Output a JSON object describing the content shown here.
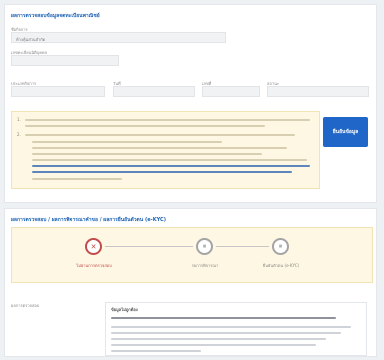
{
  "panel1": {
    "title": "ผลการตรวจสอบข้อมูลจดทะเบียนพาณิชย์",
    "fields": [
      {
        "label": "ชื่อกิจการ",
        "value": "ห้างหุ้นส่วนจำกัด"
      },
      {
        "label": "เลขทะเบียนนิติบุคคล",
        "value": ""
      },
      {
        "label": "ประเภทกิจการ",
        "value": ""
      },
      {
        "label": "วันที่",
        "value": ""
      },
      {
        "label": "เลขที่",
        "value": ""
      },
      {
        "label": "สถานะ",
        "value": ""
      }
    ],
    "notice_numbers": [
      "1.",
      "2."
    ],
    "button_label": "ยืนยันข้อมูล"
  },
  "panel2": {
    "title": "ผลการตรวจสอบ / ผลการพิจารณาคำขอ / ผลการยืนยันตัวตน (e-KYC)",
    "steps": [
      {
        "label": "ไม่ผ่านการตรวจสอบ",
        "icon": "x-icon",
        "glyph": "✕",
        "state": "error"
      },
      {
        "label": "รอการพิจารณา",
        "icon": "pause-icon",
        "glyph": "⏸",
        "state": "idle"
      },
      {
        "label": "ยืนยันตัวตน (e-KYC)",
        "icon": "pause-icon",
        "glyph": "⏸",
        "state": "idle"
      }
    ],
    "detail_label": "ผลการตรวจสอบ",
    "detail_title": "ข้อมูลไม่ถูกต้อง"
  },
  "colors": {
    "accent": "#1e63b5",
    "button": "#1f66c8",
    "error": "#c44b4b",
    "notice_bg": "#fdf7e3"
  }
}
